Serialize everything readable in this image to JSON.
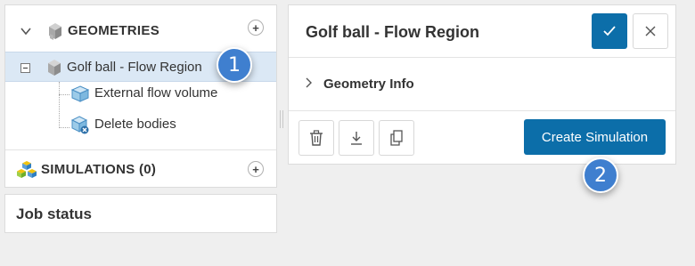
{
  "tree": {
    "geometries_label": "GEOMETRIES",
    "selected_item": "Golf ball - Flow Region",
    "children": [
      {
        "label": "External flow volume",
        "icon": "flow-volume-icon"
      },
      {
        "label": "Delete bodies",
        "icon": "delete-bodies-icon"
      }
    ],
    "simulations_label": "SIMULATIONS (0)",
    "add_symbol": "+"
  },
  "job_status": {
    "label": "Job status"
  },
  "detail": {
    "title": "Golf ball - Flow Region",
    "section_label": "Geometry Info",
    "create_button": "Create Simulation"
  },
  "badges": {
    "first": "1",
    "second": "2"
  },
  "colors": {
    "accent": "#0c6ea9",
    "badge": "#3f7fcf",
    "selected_row": "#dbe8f5",
    "background": "#efefef"
  }
}
